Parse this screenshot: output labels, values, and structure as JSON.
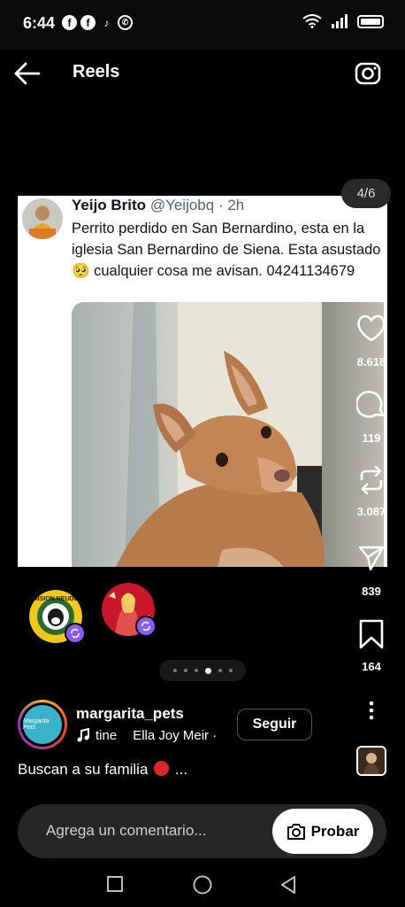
{
  "status_bar": {
    "time": "6:44",
    "apps": [
      "facebook-icon",
      "facebook-icon",
      "tiktok-icon",
      "whatsapp-icon"
    ]
  },
  "header": {
    "title": "Reels",
    "back_icon": "arrow-left-icon",
    "camera_icon": "camera-icon"
  },
  "post": {
    "author_name": "Yeijo Brito",
    "author_handle": "@Yeijobq",
    "time": "· 2h",
    "text": "Perrito perdido en San Bernardino, esta en la iglesia San Bernardino de Siena. Esta asustado 🥺 cualquier cosa me avisan. 04241134679"
  },
  "carousel": {
    "counter": "4/6",
    "current_dot": 3,
    "total_dots": 6
  },
  "actions": {
    "likes": "8.618",
    "comments": "119",
    "reposts": "3.087",
    "shares": "839",
    "saves": "164"
  },
  "tags": [
    {
      "name": "mision-neudo",
      "label": "MISION NEUDO"
    },
    {
      "name": "tagged-user-2"
    }
  ],
  "reel_author": {
    "username": "margarita_pets",
    "avatar_text": "Margarita Pets",
    "music_title": "tine",
    "music_artist": "Ella Joy Meir ·",
    "follow_label": "Seguir"
  },
  "caption": {
    "text": "Buscan a su familia",
    "more": "..."
  },
  "comment_bar": {
    "placeholder": "Agrega un comentario...",
    "button_label": "Probar"
  },
  "colors": {
    "background": "#000000",
    "accent_purple": "#8b5cf6",
    "red": "#e0242b"
  }
}
